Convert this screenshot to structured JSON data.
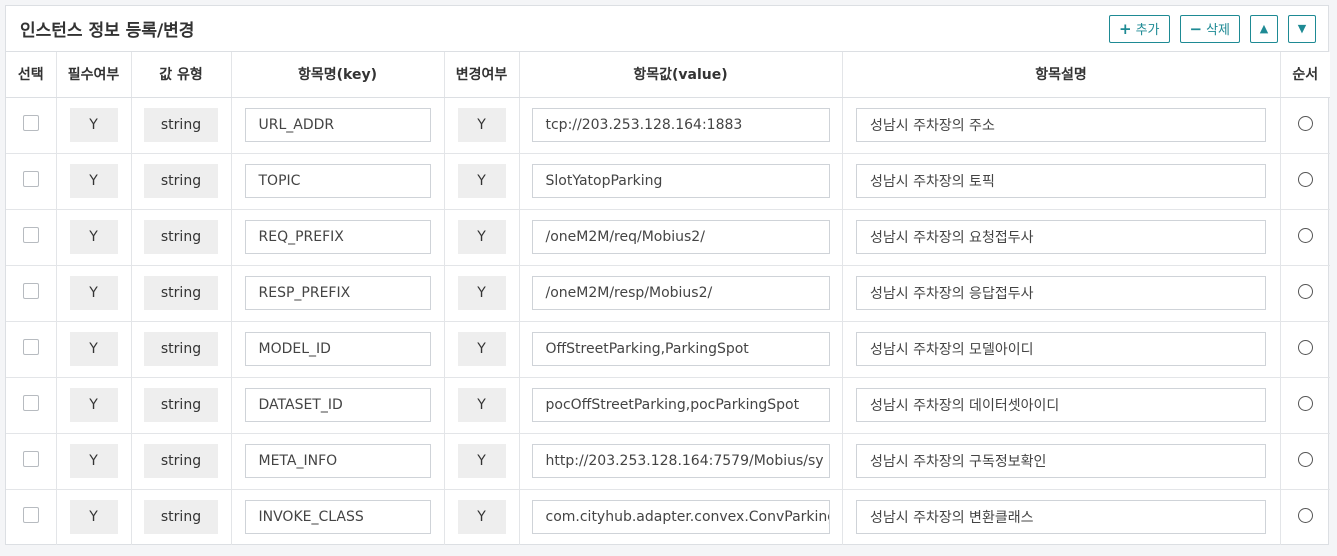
{
  "panel": {
    "title": "인스턴스 정보 등록/변경",
    "add_label": "추가",
    "delete_label": "삭제",
    "add_glyph": "+",
    "delete_glyph": "−",
    "up_glyph": "▲",
    "down_glyph": "▼"
  },
  "columns": [
    "선택",
    "필수여부",
    "값 유형",
    "항목명(key)",
    "변경여부",
    "항목값(value)",
    "항목설명",
    "순서"
  ],
  "rows": [
    {
      "required": "Y",
      "type": "string",
      "key": "URL_ADDR",
      "changeable": "Y",
      "value": "tcp://203.253.128.164:1883",
      "desc": "성남시 주차장의 주소"
    },
    {
      "required": "Y",
      "type": "string",
      "key": "TOPIC",
      "changeable": "Y",
      "value": "SlotYatopParking",
      "desc": "성남시 주차장의 토픽"
    },
    {
      "required": "Y",
      "type": "string",
      "key": "REQ_PREFIX",
      "changeable": "Y",
      "value": "/oneM2M/req/Mobius2/",
      "desc": "성남시 주차장의 요청접두사"
    },
    {
      "required": "Y",
      "type": "string",
      "key": "RESP_PREFIX",
      "changeable": "Y",
      "value": "/oneM2M/resp/Mobius2/",
      "desc": "성남시 주차장의 응답접두사"
    },
    {
      "required": "Y",
      "type": "string",
      "key": "MODEL_ID",
      "changeable": "Y",
      "value": "OffStreetParking,ParkingSpot",
      "desc": "성남시 주차장의 모델아이디"
    },
    {
      "required": "Y",
      "type": "string",
      "key": "DATASET_ID",
      "changeable": "Y",
      "value": "pocOffStreetParking,pocParkingSpot",
      "desc": "성남시 주차장의 데이터셋아이디"
    },
    {
      "required": "Y",
      "type": "string",
      "key": "META_INFO",
      "changeable": "Y",
      "value": "http://203.253.128.164:7579/Mobius/sy",
      "desc": "성남시 주차장의 구독정보확인"
    },
    {
      "required": "Y",
      "type": "string",
      "key": "INVOKE_CLASS",
      "changeable": "Y",
      "value": "com.cityhub.adapter.convex.ConvParking",
      "desc": "성남시 주차장의 변환클래스"
    }
  ]
}
